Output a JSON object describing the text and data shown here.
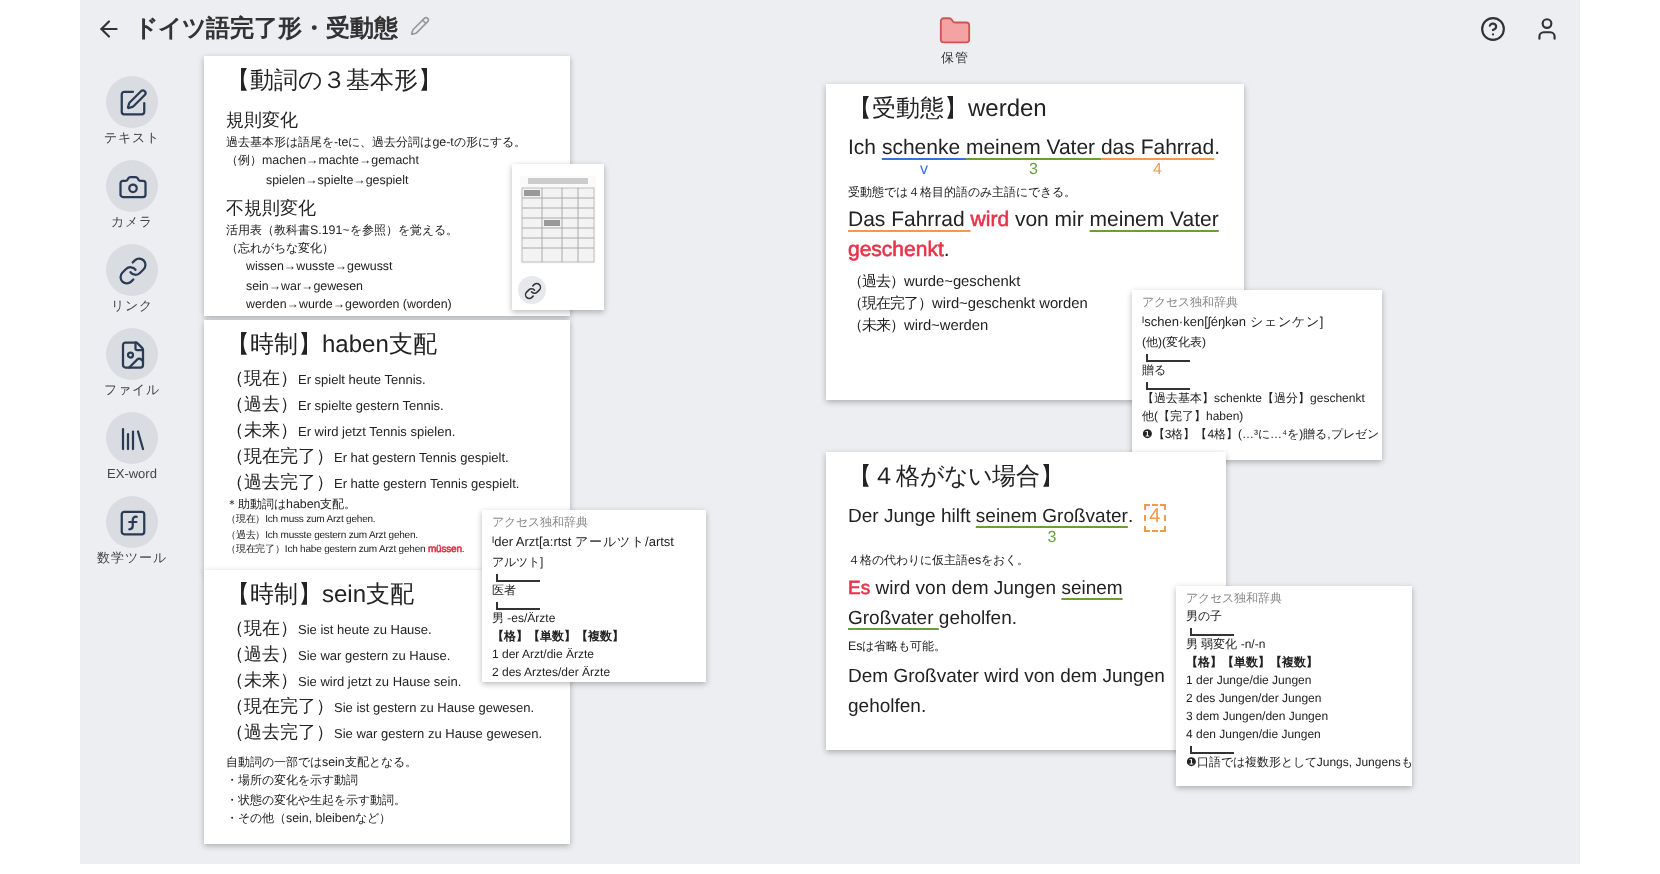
{
  "header": {
    "title": "ドイツ語完了形・受動態",
    "action": "保管"
  },
  "sidebar": [
    {
      "label": "テキスト",
      "kind": "text"
    },
    {
      "label": "カメラ",
      "kind": "camera"
    },
    {
      "label": "リンク",
      "kind": "link"
    },
    {
      "label": "ファイル",
      "kind": "file"
    },
    {
      "label": "EX-word",
      "kind": "books"
    },
    {
      "label": "数学ツール",
      "kind": "math"
    }
  ],
  "cards": [
    {
      "kind": "note",
      "lines": [
        {
          "kind": "title",
          "text": "【動詞の３基本形】"
        },
        {
          "kind": "heading",
          "text": "規則変化"
        },
        {
          "kind": "body",
          "text": "過去基本形は語尾を-teに、過去分詞はge-tの形にする。"
        },
        {
          "kind": "body",
          "text": "（例）machen→machte→gemacht"
        },
        {
          "kind": "indent2",
          "text": "spielen→spielte→gespielt"
        },
        {
          "kind": "heading",
          "text": "不規則変化"
        },
        {
          "kind": "body",
          "text": "活用表（教科書S.191~を参照）を覚える。"
        },
        {
          "kind": "body",
          "text": "（忘れがちな変化）"
        },
        {
          "kind": "indent",
          "text": "wissen→wusste→gewusst"
        },
        {
          "kind": "indent",
          "text": "sein→war→gewesen"
        },
        {
          "kind": "indent",
          "text": "werden→wurde→geworden (worden)"
        }
      ]
    },
    {
      "kind": "thumbnail"
    },
    {
      "kind": "note",
      "lines": [
        {
          "kind": "title",
          "text": "【時制】haben支配"
        },
        {
          "kind": "tense",
          "label": "（現在）",
          "text": "Er spielt heute Tennis."
        },
        {
          "kind": "tense",
          "label": "（過去）",
          "text": "Er spielte gestern Tennis."
        },
        {
          "kind": "tense",
          "label": "（未来）",
          "text": "Er wird jetzt Tennis spielen."
        },
        {
          "kind": "tense",
          "label": "（現在完了）",
          "text": "Er hat gestern Tennis gespielt."
        },
        {
          "kind": "tense",
          "label": "（過去完了）",
          "text": "Er hatte gestern Tennis gespielt."
        },
        {
          "kind": "body",
          "text": "＊助動詞はhaben支配。"
        },
        {
          "kind": "tiny",
          "text": "（現在）Ich muss zum Arzt gehen."
        },
        {
          "kind": "tiny",
          "text": "（過去）Ich musste gestern zum Arzt gehen."
        },
        {
          "kind": "tiny",
          "segments": [
            {
              "text": "（現在完了）Ich habe gestern zum Arzt gehen "
            },
            {
              "text": "müssen",
              "kind": "colored",
              "color": "#e8334a"
            },
            {
              "text": "."
            }
          ]
        }
      ]
    },
    {
      "kind": "note",
      "lines": [
        {
          "kind": "title",
          "text": "【時制】sein支配"
        },
        {
          "kind": "tense",
          "label": "（現在）",
          "text": "Sie ist heute zu Hause."
        },
        {
          "kind": "tense",
          "label": "（過去）",
          "text": "Sie war gestern zu Hause."
        },
        {
          "kind": "tense",
          "label": "（未来）",
          "text": "Sie wird jetzt zu Hause sein."
        },
        {
          "kind": "tense",
          "label": "（現在完了）",
          "text": "Sie ist gestern zu Hause gewesen."
        },
        {
          "kind": "tense",
          "label": "（過去完了）",
          "text": "Sie war gestern zu Hause gewesen."
        },
        {
          "kind": "gap"
        },
        {
          "kind": "body",
          "text": "自動詞の一部ではsein支配となる。"
        },
        {
          "kind": "body",
          "text": "・場所の変化を示す動詞"
        },
        {
          "kind": "body",
          "text": "・状態の変化や生起を示す動詞。"
        },
        {
          "kind": "body",
          "text": "・その他（sein, bleibenなど）"
        }
      ]
    },
    {
      "kind": "dictionary",
      "lines": [
        {
          "kind": "source",
          "text": "アクセス独和辞典"
        },
        {
          "kind": "headword",
          "text": "ᴵder Arzt[a:rtst アールツト/artst"
        },
        {
          "kind": "small",
          "text": "アルツト]"
        },
        {
          "kind": "rule"
        },
        {
          "kind": "small",
          "text": "医者"
        },
        {
          "kind": "rule"
        },
        {
          "kind": "small",
          "text": "男 -es/Ärzte"
        },
        {
          "kind": "bold",
          "text": "【格】【単数】【複数】"
        },
        {
          "kind": "small",
          "text": "1 der Arzt/die Ärzte"
        },
        {
          "kind": "small",
          "text": "2 des Arztes/der Ärzte"
        }
      ]
    },
    {
      "kind": "note",
      "lines": [
        {
          "kind": "title",
          "text": "【受動態】werden"
        },
        {
          "kind": "sentence",
          "segments": [
            {
              "text": "Ich "
            },
            {
              "text": "schenke ",
              "kind": "underline",
              "color": "#3a6fd8",
              "note": "v"
            },
            {
              "text": "meinem Vater ",
              "kind": "underline",
              "color": "#6a9e3c",
              "note": "3"
            },
            {
              "text": "das Fahrrad",
              "kind": "underline",
              "color": "#ee9a50",
              "note": "4"
            },
            {
              "text": "."
            }
          ]
        },
        {
          "kind": "body",
          "text": "受動態では４格目的語のみ主語にできる。"
        },
        {
          "kind": "sentence",
          "segments": [
            {
              "text": "Das Fahrrad ",
              "kind": "underline",
              "color": "#ee9a50"
            },
            {
              "text": "wird ",
              "kind": "colored",
              "color": "#e8334a"
            },
            {
              "text": "von mir "
            },
            {
              "text": "meinem Vater ",
              "kind": "underline",
              "color": "#6a9e3c"
            },
            {
              "text": "geschenkt",
              "kind": "colored",
              "color": "#e8334a"
            },
            {
              "text": "."
            }
          ]
        },
        {
          "kind": "tense2",
          "text": "（過去）wurde~geschenkt"
        },
        {
          "kind": "tense2",
          "text": "（現在完了）wird~geschenkt worden"
        },
        {
          "kind": "tense2",
          "text": "（未来）wird~werden"
        }
      ]
    },
    {
      "kind": "dictionary",
      "lines": [
        {
          "kind": "source",
          "text": "アクセス独和辞典"
        },
        {
          "kind": "headword",
          "text": "ᴵschen·ken[ʃéŋkən シェンケン]"
        },
        {
          "kind": "small",
          "text": "(他)(変化表)"
        },
        {
          "kind": "rule"
        },
        {
          "kind": "small",
          "text": "贈る"
        },
        {
          "kind": "rule"
        },
        {
          "kind": "small",
          "text": "【過去基本】schenkte【過分】geschenkt"
        },
        {
          "kind": "small",
          "text": "他(【完了】haben)"
        },
        {
          "kind": "small",
          "text": "❶【3格】【4格】(…³に…⁴を)贈る,プレゼン"
        }
      ]
    },
    {
      "kind": "note",
      "lines": [
        {
          "kind": "title",
          "text": "【４格がない場合】"
        },
        {
          "kind": "sentence",
          "segments": [
            {
              "text": "Der Junge hilft "
            },
            {
              "text": "seinem Großvater",
              "kind": "underline",
              "color": "#6a9e3c",
              "note": "3"
            },
            {
              "text": "."
            },
            {
              "text": "4",
              "kind": "box",
              "color": "#ee9a50"
            }
          ]
        },
        {
          "kind": "body",
          "text": "４格の代わりに仮主語esをおく。"
        },
        {
          "kind": "sentence",
          "segments": [
            {
              "text": "Es ",
              "kind": "colored",
              "color": "#e8334a"
            },
            {
              "text": "wird von dem Jungen "
            },
            {
              "text": "seinem Großvater ",
              "kind": "underline",
              "color": "#6a9e3c"
            },
            {
              "text": "geholfen."
            }
          ]
        },
        {
          "kind": "body",
          "text": "Esは省略も可能。"
        },
        {
          "kind": "sentence",
          "segments": [
            {
              "text": "Dem Großvater wird von dem Jungen geholfen."
            }
          ]
        }
      ]
    },
    {
      "kind": "dictionary",
      "lines": [
        {
          "kind": "source",
          "text": "アクセス独和辞典"
        },
        {
          "kind": "small",
          "text": "男の子"
        },
        {
          "kind": "rule"
        },
        {
          "kind": "small",
          "text": "男 弱変化 -n/-n"
        },
        {
          "kind": "bold",
          "text": "【格】【単数】【複数】"
        },
        {
          "kind": "small",
          "text": "1 der Junge/die Jungen"
        },
        {
          "kind": "small",
          "text": "2 des Jungen/der Jungen"
        },
        {
          "kind": "small",
          "text": "3 dem Jungen/den Jungen"
        },
        {
          "kind": "small",
          "text": "4 den Jungen/die Jungen"
        },
        {
          "kind": "rule"
        },
        {
          "kind": "small",
          "text": "❶口語では複数形としてJungs, Jungensも"
        }
      ]
    }
  ]
}
